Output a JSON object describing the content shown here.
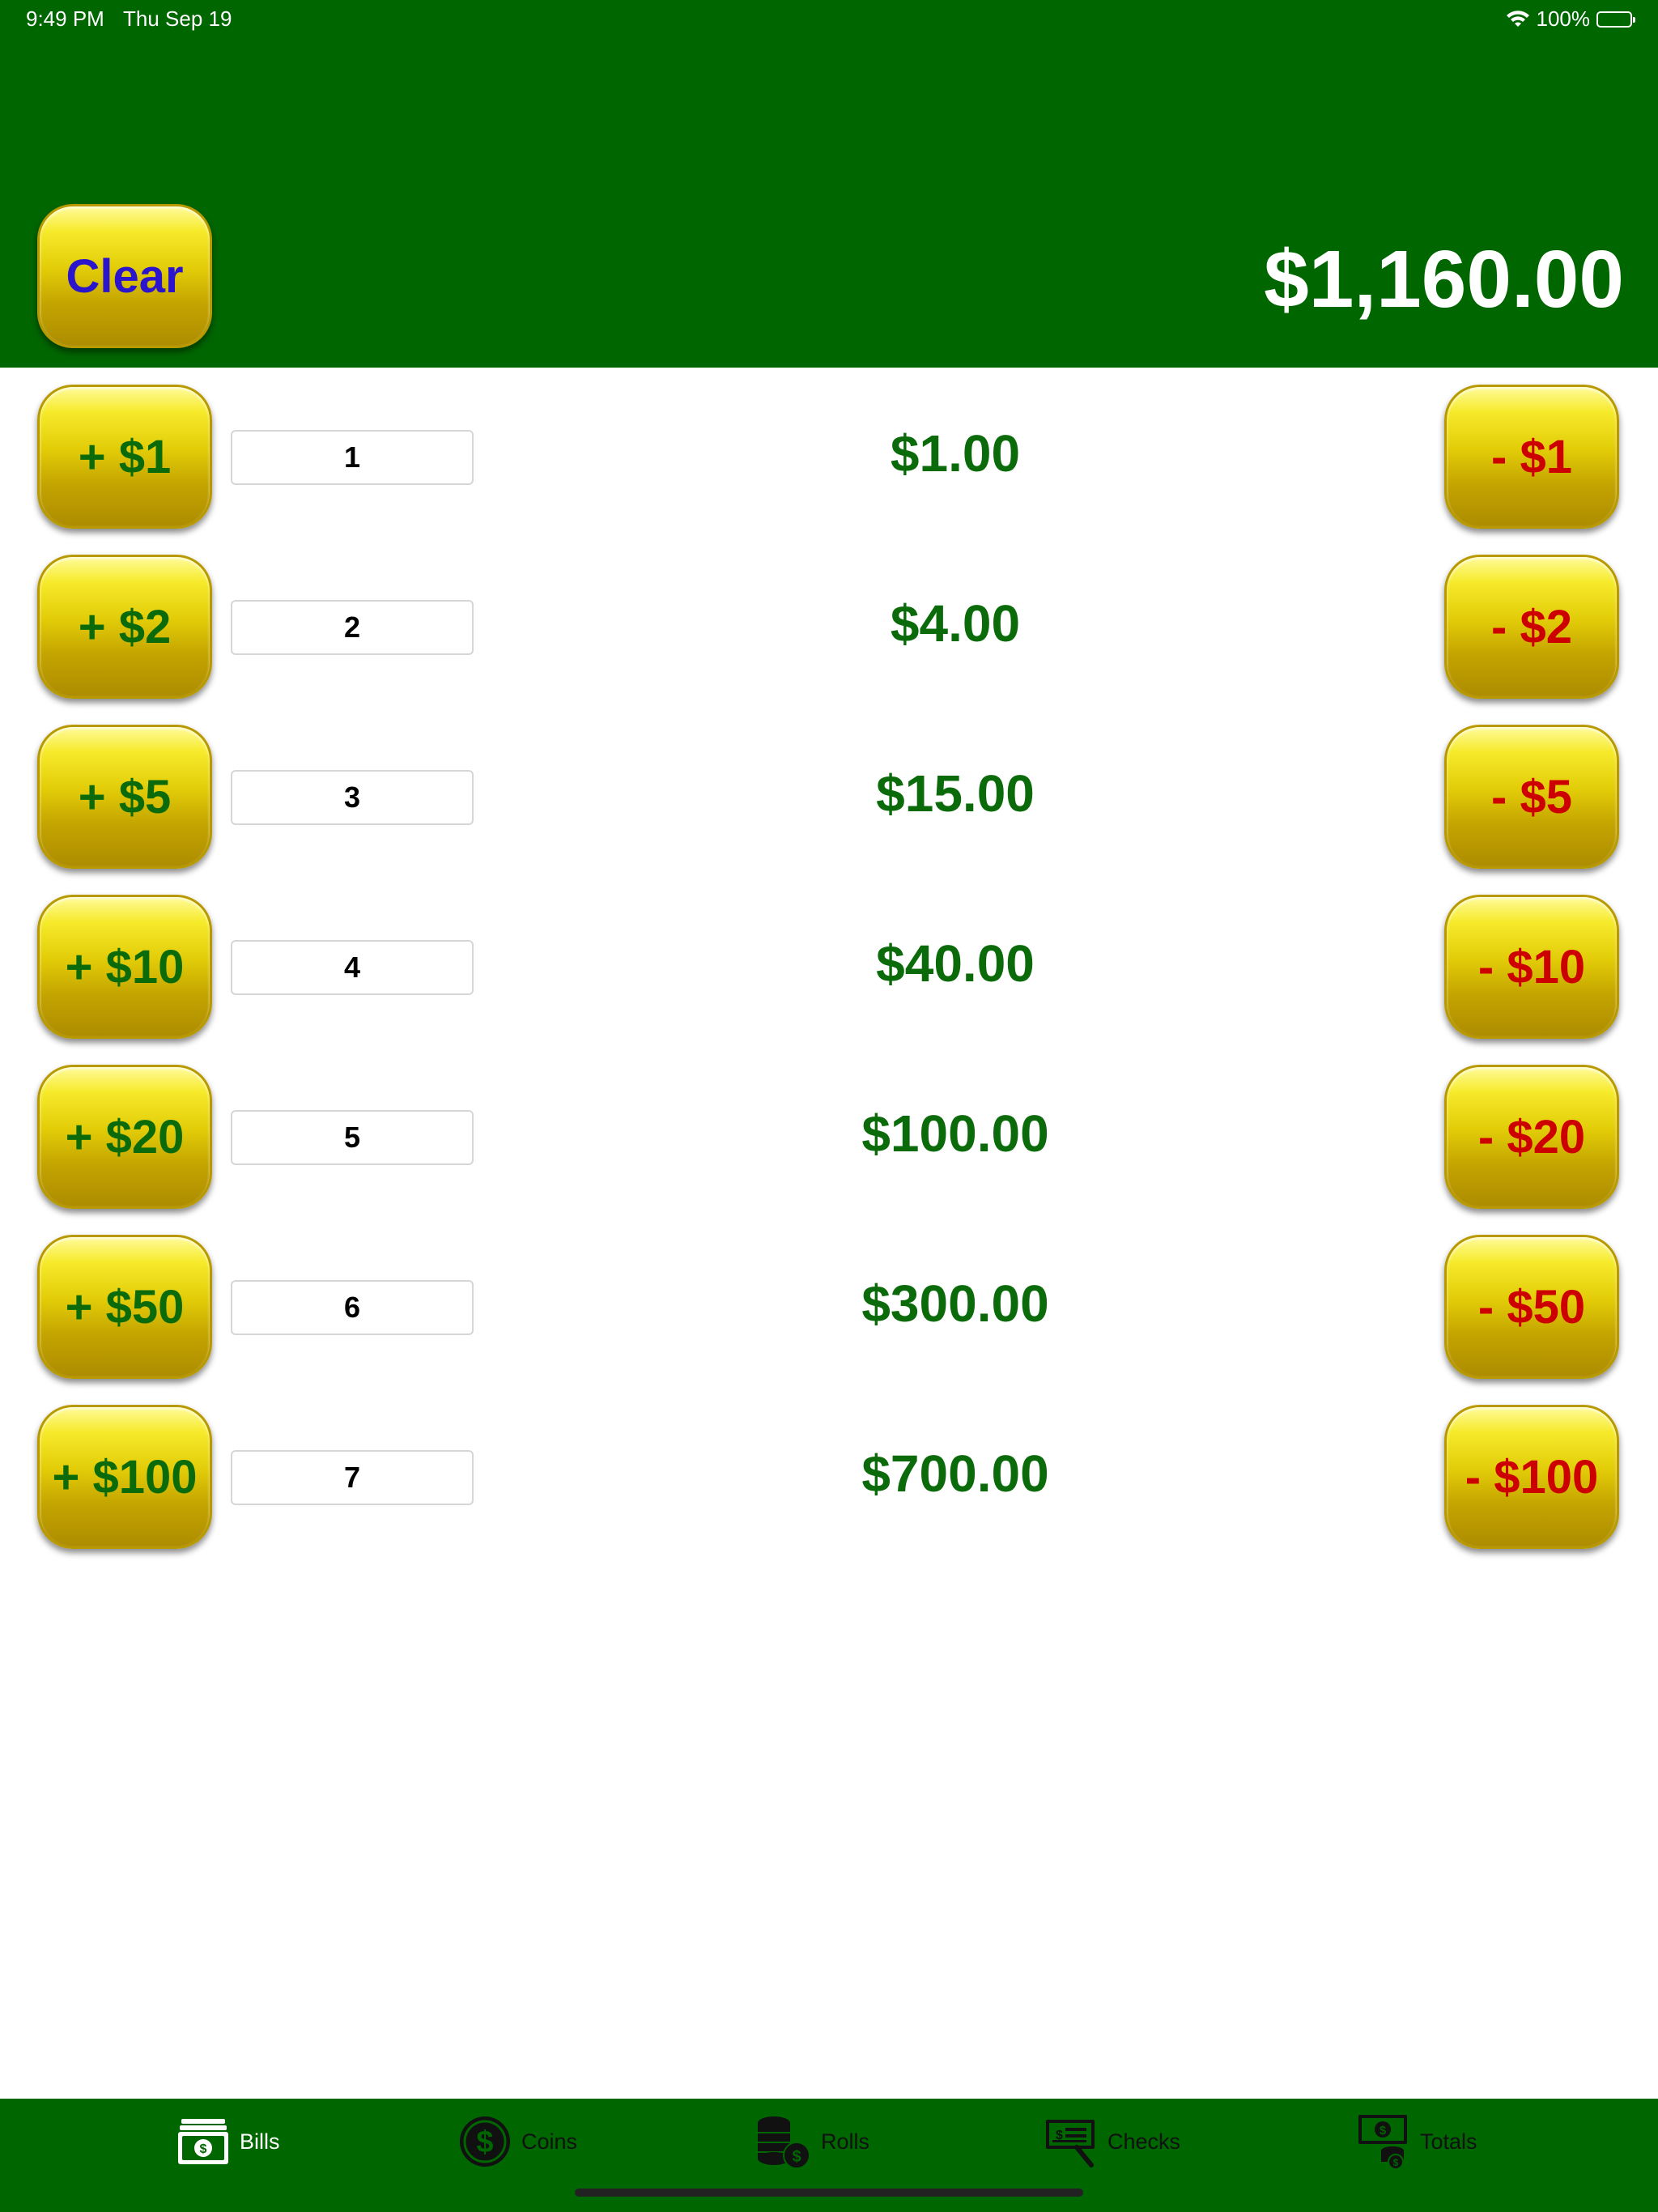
{
  "status_bar": {
    "time": "9:49 PM",
    "date": "Thu Sep 19",
    "battery": "100%"
  },
  "header": {
    "clear_label": "Clear",
    "total": "$1,160.00"
  },
  "rows": [
    {
      "plus": "+ $1",
      "count": "1",
      "amount": "$1.00",
      "minus": "- $1"
    },
    {
      "plus": "+ $2",
      "count": "2",
      "amount": "$4.00",
      "minus": "- $2"
    },
    {
      "plus": "+ $5",
      "count": "3",
      "amount": "$15.00",
      "minus": "- $5"
    },
    {
      "plus": "+ $10",
      "count": "4",
      "amount": "$40.00",
      "minus": "- $10"
    },
    {
      "plus": "+ $20",
      "count": "5",
      "amount": "$100.00",
      "minus": "- $20"
    },
    {
      "plus": "+ $50",
      "count": "6",
      "amount": "$300.00",
      "minus": "- $50"
    },
    {
      "plus": "+ $100",
      "count": "7",
      "amount": "$700.00",
      "minus": "- $100"
    }
  ],
  "tabs": [
    {
      "label": "Bills",
      "icon": "bills-icon",
      "active": true
    },
    {
      "label": "Coins",
      "icon": "coins-icon",
      "active": false
    },
    {
      "label": "Rolls",
      "icon": "rolls-icon",
      "active": false
    },
    {
      "label": "Checks",
      "icon": "checks-icon",
      "active": false
    },
    {
      "label": "Totals",
      "icon": "totals-icon",
      "active": false
    }
  ],
  "colors": {
    "header_green": "#006600",
    "amount_green": "#0b6b0b",
    "minus_red": "#cc0000",
    "clear_blue": "#2a14cc",
    "gold": "#e2cc08"
  }
}
